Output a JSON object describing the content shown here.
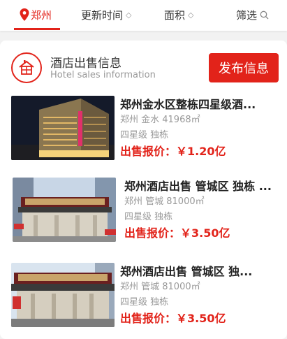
{
  "filters": {
    "city": "郑州",
    "update_time": "更新时间",
    "area": "面积",
    "filter": "筛选"
  },
  "header": {
    "title": "酒店出售信息",
    "subtitle": "Hotel sales information",
    "publish_label": "发布信息"
  },
  "listings": [
    {
      "title": "郑州金水区整栋四星级酒...",
      "location": "郑州 金水 41968㎡",
      "tags": "四星级 独栋",
      "price": "出售报价：￥1.20亿"
    },
    {
      "title": "郑州酒店出售 管城区 独栋 ...",
      "location": "郑州 管城 81000㎡",
      "tags": "四星级 独栋",
      "price": "出售报价：￥3.50亿"
    },
    {
      "title": "郑州酒店出售 管城区 独...",
      "location": "郑州 管城 81000㎡",
      "tags": "四星级 独栋",
      "price": "出售报价：￥3.50亿"
    }
  ],
  "colors": {
    "accent": "#e2231a"
  }
}
